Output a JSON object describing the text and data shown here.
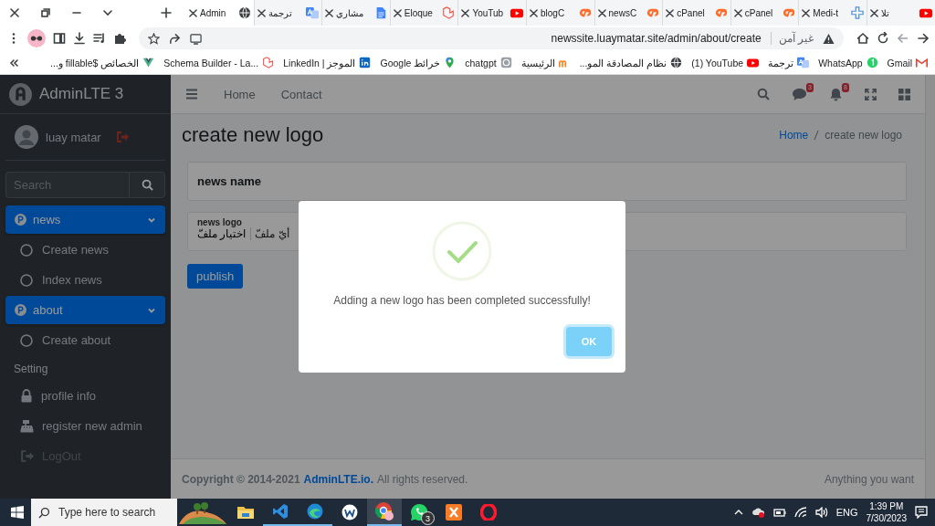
{
  "browser": {
    "tabs": [
      {
        "title": "Admin",
        "selected": true
      },
      {
        "title": "ترجمة",
        "selected": false
      },
      {
        "title": "مشاري",
        "selected": false
      },
      {
        "title": "Eloque",
        "selected": false
      },
      {
        "title": "YouTub",
        "selected": false
      },
      {
        "title": "blogC",
        "selected": false
      },
      {
        "title": "newsC",
        "selected": false
      },
      {
        "title": "cPanel",
        "selected": false
      },
      {
        "title": "cPanel",
        "selected": false
      },
      {
        "title": "Medi-t",
        "selected": false
      },
      {
        "title": "تلا",
        "selected": false
      }
    ],
    "address_bar": {
      "url": "newssite.luaymatar.site/admin/about/create",
      "security": "غير آمن"
    },
    "bookmarks": [
      {
        "label": "الخصائص $fillable و..."
      },
      {
        "label": "Schema Builder - La..."
      },
      {
        "label": "LinkedIn | الموجز"
      },
      {
        "label": "خرائط Google"
      },
      {
        "label": "chatgpt"
      },
      {
        "label": "الرئيسية"
      },
      {
        "label": "نظام المصادقة المو..."
      },
      {
        "label": "(1) YouTube"
      },
      {
        "label": "ترجمة"
      },
      {
        "label": "WhatsApp"
      },
      {
        "label": "Gmail"
      }
    ]
  },
  "sidebar": {
    "brand": "AdminLTE 3",
    "user": "luay matar",
    "search_placeholder": "Search",
    "menu": [
      {
        "kind": "tree",
        "label": "news",
        "selected": true,
        "expanded": true,
        "disabled": false,
        "children": [
          {
            "label": "Create news",
            "selected": false
          },
          {
            "label": "Index news",
            "selected": false
          }
        ]
      },
      {
        "kind": "tree",
        "label": "about",
        "selected": true,
        "expanded": true,
        "disabled": false,
        "children": [
          {
            "label": "Create about",
            "selected": false
          }
        ]
      },
      {
        "kind": "header",
        "label": "Setting"
      },
      {
        "kind": "link",
        "label": "profile info",
        "selected": false,
        "disabled": false
      },
      {
        "kind": "link",
        "label": "register new admin",
        "selected": false,
        "disabled": false
      },
      {
        "kind": "link",
        "label": "LogOut",
        "selected": false,
        "disabled": true
      }
    ]
  },
  "navbar": {
    "links": [
      "Home",
      "Contact"
    ],
    "message_count": "3",
    "notification_count": "8"
  },
  "content": {
    "title": "create new logo",
    "breadcrumb": [
      {
        "label": "Home",
        "link": true
      },
      {
        "label": "create new logo",
        "link": false
      }
    ],
    "form": {
      "name_label": "news name",
      "file_label": "news logo",
      "file_button": "اختيار ملفّ",
      "file_status": "أيّ ملفّ",
      "submit": "publish"
    }
  },
  "footer": {
    "copyright": "Copyright © 2014-2021",
    "link": "AdminLTE.io.",
    "rights": "All rights reserved.",
    "right_text": "Anything you want"
  },
  "dialog": {
    "message": "Adding a new logo has been completed successfully!",
    "button": "OK"
  },
  "taskbar": {
    "search_placeholder": "Type here to search",
    "apps": [
      {
        "kind": "landscape",
        "running": false,
        "selected": false
      },
      {
        "kind": "folder",
        "running": false,
        "selected": false
      },
      {
        "kind": "code",
        "running": true,
        "selected": false
      },
      {
        "kind": "wave",
        "running": true,
        "selected": false
      },
      {
        "kind": "writer",
        "running": false,
        "selected": false
      },
      {
        "kind": "browser",
        "running": true,
        "selected": true
      },
      {
        "kind": "chat",
        "running": false,
        "selected": false,
        "badge": "3"
      },
      {
        "kind": "server",
        "running": false,
        "selected": false
      },
      {
        "kind": "ring",
        "running": false,
        "selected": false
      }
    ],
    "language": "ENG",
    "time": "1:39 PM",
    "date": "7/30/2023"
  }
}
